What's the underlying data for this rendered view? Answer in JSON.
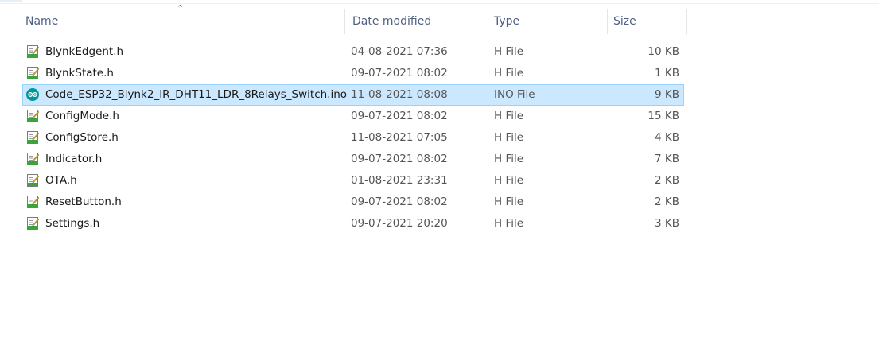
{
  "columns": {
    "name": "Name",
    "date": "Date modified",
    "type": "Type",
    "size": "Size"
  },
  "sort": {
    "column": "Name",
    "indicator": "^"
  },
  "files": [
    {
      "name": "BlynkEdgent.h",
      "date": "04-08-2021 07:36",
      "type": "H File",
      "size": "10 KB",
      "icon": "h-file-icon",
      "selected": false
    },
    {
      "name": "BlynkState.h",
      "date": "09-07-2021 08:02",
      "type": "H File",
      "size": "1 KB",
      "icon": "h-file-icon",
      "selected": false
    },
    {
      "name": "Code_ESP32_Blynk2_IR_DHT11_LDR_8Relays_Switch.ino",
      "date": "11-08-2021 08:08",
      "type": "INO File",
      "size": "9 KB",
      "icon": "arduino-icon",
      "selected": true
    },
    {
      "name": "ConfigMode.h",
      "date": "09-07-2021 08:02",
      "type": "H File",
      "size": "15 KB",
      "icon": "h-file-icon",
      "selected": false
    },
    {
      "name": "ConfigStore.h",
      "date": "11-08-2021 07:05",
      "type": "H File",
      "size": "4 KB",
      "icon": "h-file-icon",
      "selected": false
    },
    {
      "name": "Indicator.h",
      "date": "09-07-2021 08:02",
      "type": "H File",
      "size": "7 KB",
      "icon": "h-file-icon",
      "selected": false
    },
    {
      "name": "OTA.h",
      "date": "01-08-2021 23:31",
      "type": "H File",
      "size": "2 KB",
      "icon": "h-file-icon",
      "selected": false
    },
    {
      "name": "ResetButton.h",
      "date": "09-07-2021 08:02",
      "type": "H File",
      "size": "2 KB",
      "icon": "h-file-icon",
      "selected": false
    },
    {
      "name": "Settings.h",
      "date": "09-07-2021 20:20",
      "type": "H File",
      "size": "3 KB",
      "icon": "h-file-icon",
      "selected": false
    }
  ],
  "colors": {
    "selection_bg": "#cce8ff",
    "selection_border": "#99d1ff",
    "header_text": "#4d6082",
    "arduino_teal": "#00979c"
  }
}
